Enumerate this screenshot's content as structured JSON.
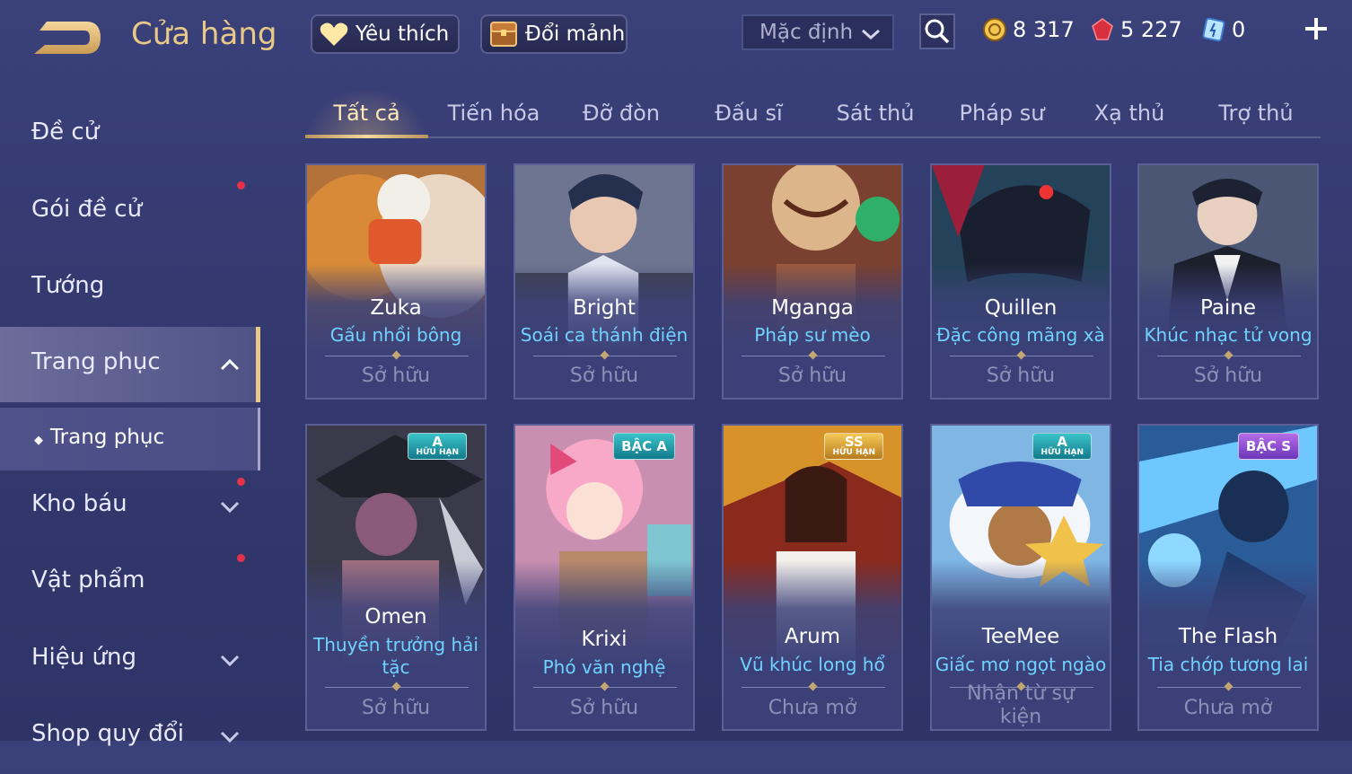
{
  "header": {
    "title": "Cửa hàng",
    "favorite_label": "Yêu thích",
    "trade_label": "Đổi mảnh",
    "sort_label": "Mặc định",
    "currencies": [
      {
        "icon": "gold-coin-icon",
        "value": "8 317"
      },
      {
        "icon": "red-gem-icon",
        "value": "5 227"
      },
      {
        "icon": "blue-voucher-icon",
        "value": "0"
      }
    ]
  },
  "sidebar": {
    "items": [
      {
        "label": "Đề cử"
      },
      {
        "label": "Gói đề cử",
        "notification": true
      },
      {
        "label": "Tướng"
      },
      {
        "label": "Trang phục",
        "expanded": true,
        "active": true
      },
      {
        "label": "Kho báu",
        "notification": true,
        "expandable": true
      },
      {
        "label": "Vật phẩm",
        "notification": true
      },
      {
        "label": "Hiệu ứng",
        "expandable": true
      },
      {
        "label": "Shop quy đổi",
        "expandable": true
      }
    ],
    "subitem": "Trang phục"
  },
  "tabs": [
    "Tất cả",
    "Tiến hóa",
    "Đỡ đòn",
    "Đấu sĩ",
    "Sát thủ",
    "Pháp sư",
    "Xạ thủ",
    "Trợ thủ"
  ],
  "active_tab": "Tất cả",
  "cards": [
    {
      "hero": "Zuka",
      "skin": "Gấu nhồi bông",
      "status": "Sở hữu"
    },
    {
      "hero": "Bright",
      "skin": "Soái ca thánh điện",
      "status": "Sở hữu"
    },
    {
      "hero": "Mganga",
      "skin": "Pháp sư mèo",
      "status": "Sở hữu"
    },
    {
      "hero": "Quillen",
      "skin": "Đặc công mãng xà",
      "status": "Sở hữu"
    },
    {
      "hero": "Paine",
      "skin": "Khúc nhạc tử vong",
      "status": "Sở hữu"
    },
    {
      "hero": "Omen",
      "skin": "Thuyền trưởng hải tặc",
      "status": "Sở hữu",
      "badge": "A",
      "badge_sub": "HỮU HẠN"
    },
    {
      "hero": "Krixi",
      "skin": "Phó văn nghệ",
      "status": "Sở hữu",
      "badge": "BẬC A"
    },
    {
      "hero": "Arum",
      "skin": "Vũ khúc long hổ",
      "status": "Chưa mở",
      "badge": "SS",
      "badge_sub": "HỮU HẠN"
    },
    {
      "hero": "TeeMee",
      "skin": "Giấc mơ ngọt ngào",
      "status": "Nhận từ sự kiện",
      "badge": "A",
      "badge_sub": "HỮU HẠN"
    },
    {
      "hero": "The Flash",
      "skin": "Tia chớp tương lai",
      "status": "Chưa mở",
      "badge": "BẬC S"
    }
  ],
  "colors": {
    "accent_gold": "#e9c989",
    "skin_name": "#6fd2ff",
    "notify_red": "#e5324b"
  }
}
